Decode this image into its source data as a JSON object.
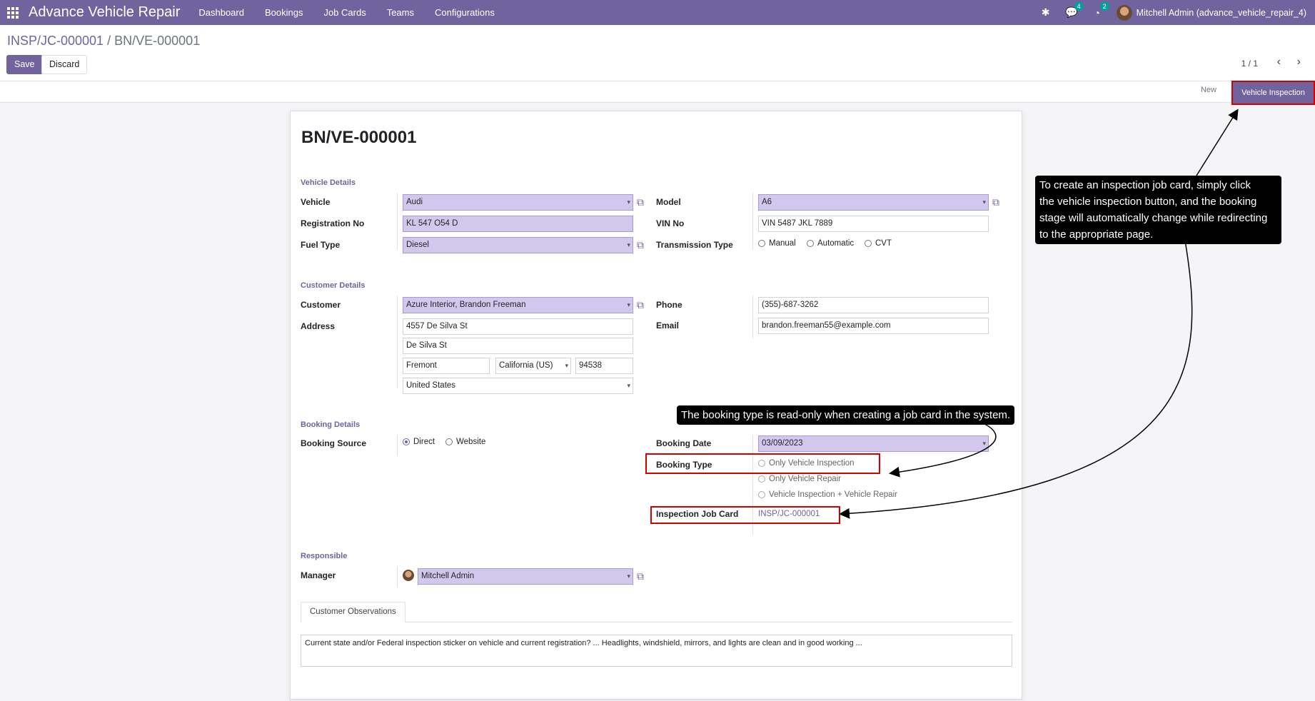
{
  "app": {
    "title": "Advance Vehicle Repair",
    "menu": [
      "Dashboard",
      "Bookings",
      "Job Cards",
      "Teams",
      "Configurations"
    ],
    "messages_count": "4",
    "activities_count": "2",
    "user": "Mitchell Admin (advance_vehicle_repair_4)"
  },
  "breadcrumb": {
    "parent": "INSP/JC-000001",
    "separator": "/",
    "current": "BN/VE-000001"
  },
  "actions": {
    "save": "Save",
    "discard": "Discard"
  },
  "pager": {
    "text": "1 / 1",
    "prev": "‹",
    "next": "›"
  },
  "statusbar": {
    "stage_new": "New",
    "stage_active": "Vehicle Inspection"
  },
  "record": {
    "title": "BN/VE-000001",
    "vehicle_details": {
      "group_title": "Vehicle Details",
      "vehicle_label": "Vehicle",
      "vehicle": "Audi",
      "registration_label": "Registration No",
      "registration": "KL 547 O54 D",
      "fuel_label": "Fuel Type",
      "fuel": "Diesel",
      "model_label": "Model",
      "model": "A6",
      "vin_label": "VIN No",
      "vin": "VIN 5487 JKL 7889",
      "transmission_label": "Transmission Type",
      "transmission_options": [
        "Manual",
        "Automatic",
        "CVT"
      ]
    },
    "customer_details": {
      "group_title": "Customer Details",
      "customer_label": "Customer",
      "customer": "Azure Interior, Brandon Freeman",
      "address_label": "Address",
      "street": "4557 De Silva St",
      "street2": "De Silva St",
      "city": "Fremont",
      "state": "California (US)",
      "zip": "94538",
      "country": "United States",
      "phone_label": "Phone",
      "phone": "(355)-687-3262",
      "email_label": "Email",
      "email": "brandon.freeman55@example.com"
    },
    "booking_details": {
      "group_title": "Booking Details",
      "source_label": "Booking Source",
      "source_options": [
        "Direct",
        "Website"
      ],
      "date_label": "Booking Date",
      "date": "03/09/2023",
      "type_label": "Booking Type",
      "type_options": [
        "Only Vehicle Inspection",
        "Only Vehicle Repair",
        "Vehicle Inspection + Vehicle Repair"
      ],
      "inspection_label": "Inspection Job Card",
      "inspection": "INSP/JC-000001"
    },
    "responsible": {
      "group_title": "Responsible",
      "manager_label": "Manager",
      "manager": "Mitchell Admin"
    },
    "tabs": {
      "observations": "Customer Observations"
    },
    "observations_text": "Current state and/or Federal inspection sticker on vehicle and current registration? ... Headlights, windshield, mirrors, and lights are clean and in good working ..."
  },
  "annotations": {
    "tip_inspection": [
      "To create an inspection job card, simply click",
      "the vehicle inspection button, and the booking",
      "stage will automatically change while redirecting",
      "to the appropriate page."
    ],
    "tip_booking_type": "The booking type is read-only when creating a job card in the system."
  },
  "colors": {
    "brand": "#71639e",
    "required_field": "#d2c8ee",
    "highlight": "#d40000"
  },
  "icons": [
    "apps-grid-icon",
    "bug-icon",
    "chat-icon",
    "clock-icon",
    "external-link-icon",
    "chevron-left-icon",
    "chevron-right-icon"
  ]
}
